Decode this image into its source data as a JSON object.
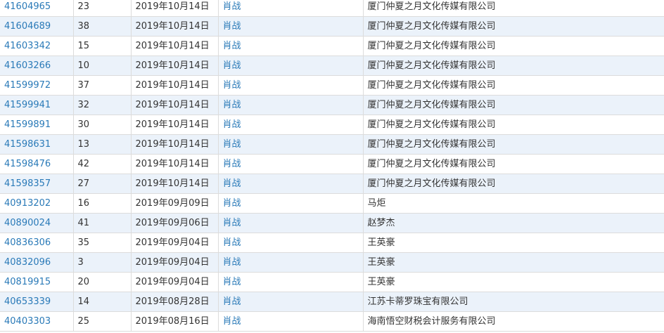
{
  "table": {
    "rows": [
      {
        "id": "41604965",
        "count": "23",
        "date": "2019年10月14日",
        "name": "肖战",
        "company": "厦门仲夏之月文化传媒有限公司"
      },
      {
        "id": "41604689",
        "count": "38",
        "date": "2019年10月14日",
        "name": "肖战",
        "company": "厦门仲夏之月文化传媒有限公司"
      },
      {
        "id": "41603342",
        "count": "15",
        "date": "2019年10月14日",
        "name": "肖战",
        "company": "厦门仲夏之月文化传媒有限公司"
      },
      {
        "id": "41603266",
        "count": "10",
        "date": "2019年10月14日",
        "name": "肖战",
        "company": "厦门仲夏之月文化传媒有限公司"
      },
      {
        "id": "41599972",
        "count": "37",
        "date": "2019年10月14日",
        "name": "肖战",
        "company": "厦门仲夏之月文化传媒有限公司"
      },
      {
        "id": "41599941",
        "count": "32",
        "date": "2019年10月14日",
        "name": "肖战",
        "company": "厦门仲夏之月文化传媒有限公司"
      },
      {
        "id": "41599891",
        "count": "30",
        "date": "2019年10月14日",
        "name": "肖战",
        "company": "厦门仲夏之月文化传媒有限公司"
      },
      {
        "id": "41598631",
        "count": "13",
        "date": "2019年10月14日",
        "name": "肖战",
        "company": "厦门仲夏之月文化传媒有限公司"
      },
      {
        "id": "41598476",
        "count": "42",
        "date": "2019年10月14日",
        "name": "肖战",
        "company": "厦门仲夏之月文化传媒有限公司"
      },
      {
        "id": "41598357",
        "count": "27",
        "date": "2019年10月14日",
        "name": "肖战",
        "company": "厦门仲夏之月文化传媒有限公司"
      },
      {
        "id": "40913202",
        "count": "16",
        "date": "2019年09月09日",
        "name": "肖战",
        "company": "马炬"
      },
      {
        "id": "40890024",
        "count": "41",
        "date": "2019年09月06日",
        "name": "肖战",
        "company": "赵梦杰"
      },
      {
        "id": "40836306",
        "count": "35",
        "date": "2019年09月04日",
        "name": "肖战",
        "company": "王英豪"
      },
      {
        "id": "40832096",
        "count": "3",
        "date": "2019年09月04日",
        "name": "肖战",
        "company": "王英豪"
      },
      {
        "id": "40819915",
        "count": "20",
        "date": "2019年09月04日",
        "name": "肖战",
        "company": "王英豪"
      },
      {
        "id": "40653339",
        "count": "14",
        "date": "2019年08月28日",
        "name": "肖战",
        "company": "江苏卡蒂罗珠宝有限公司"
      },
      {
        "id": "40403303",
        "count": "25",
        "date": "2019年08月16日",
        "name": "肖战",
        "company": "海南悟空财税会计服务有限公司"
      }
    ]
  }
}
